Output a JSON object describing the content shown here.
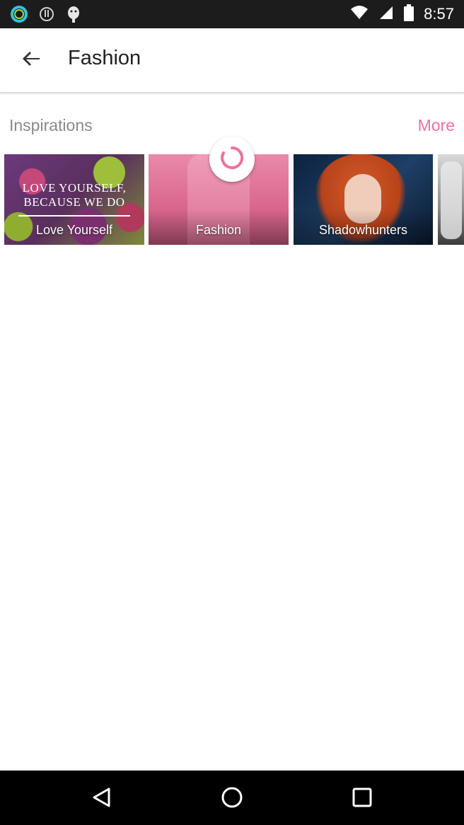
{
  "status_bar": {
    "time": "8:57",
    "icons_left": [
      "ring-app-icon",
      "alert-icon",
      "android-icon"
    ],
    "icons_right": [
      "wifi-icon",
      "signal-icon",
      "battery-icon"
    ]
  },
  "header": {
    "title": "Fashion",
    "back_icon": "arrow-back-icon"
  },
  "section": {
    "title": "Inspirations",
    "more_label": "More",
    "more_color": "#f0709a"
  },
  "tiles": [
    {
      "label": "Love Yourself",
      "quote_line1": "LOVE YOURSELF,",
      "quote_line2": "BECAUSE WE DO"
    },
    {
      "label": "Fashion"
    },
    {
      "label": "Shadowhunters"
    },
    {
      "label": ""
    }
  ],
  "loading": {
    "icon": "loading-spinner-icon",
    "color": "#f0709a"
  },
  "nav_bar": {
    "icons": [
      "back-triangle-icon",
      "home-circle-icon",
      "recents-square-icon"
    ]
  }
}
